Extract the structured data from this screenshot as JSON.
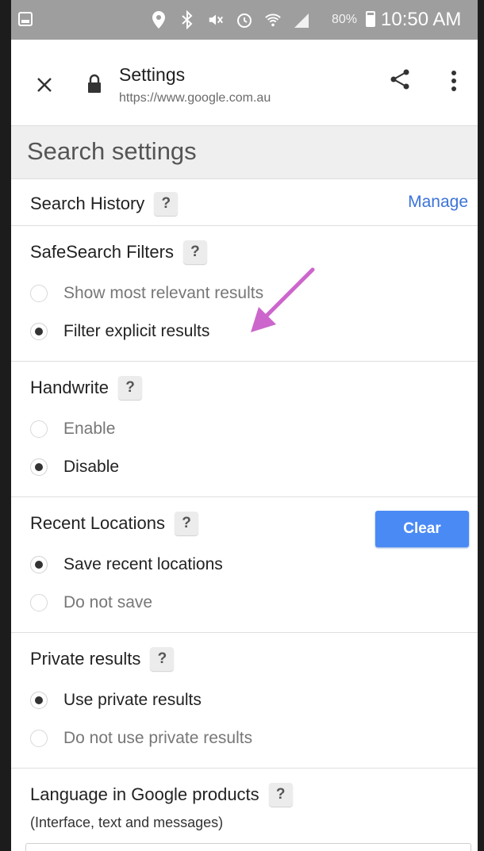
{
  "status_bar": {
    "battery_percent": "80%",
    "time": "10:50 AM",
    "icons": [
      "image-icon",
      "location-icon",
      "bluetooth-icon",
      "mute-icon",
      "alarm-icon",
      "wifi-icon",
      "signal-icon",
      "battery-icon"
    ]
  },
  "appbar": {
    "title": "Settings",
    "url": "https://www.google.com.au"
  },
  "page": {
    "heading": "Search settings"
  },
  "sections": {
    "search_history": {
      "title": "Search History",
      "help": "?",
      "action": "Manage"
    },
    "safesearch": {
      "title": "SafeSearch Filters",
      "help": "?",
      "options": [
        {
          "label": "Show most relevant results",
          "selected": false
        },
        {
          "label": "Filter explicit results",
          "selected": true
        }
      ]
    },
    "handwrite": {
      "title": "Handwrite",
      "help": "?",
      "options": [
        {
          "label": "Enable",
          "selected": false
        },
        {
          "label": "Disable",
          "selected": true
        }
      ]
    },
    "recent_locations": {
      "title": "Recent Locations",
      "help": "?",
      "action": "Clear",
      "options": [
        {
          "label": "Save recent locations",
          "selected": true
        },
        {
          "label": "Do not save",
          "selected": false
        }
      ]
    },
    "private_results": {
      "title": "Private results",
      "help": "?",
      "options": [
        {
          "label": "Use private results",
          "selected": true
        },
        {
          "label": "Do not use private results",
          "selected": false
        }
      ]
    },
    "language": {
      "title": "Language in Google products",
      "help": "?",
      "subtitle": "(Interface, text and messages)"
    }
  },
  "colors": {
    "accent_link": "#3b73d9",
    "clear_button": "#4a8af4",
    "annotation_arrow": "#cc66cc",
    "status_bar": "#9e9e9e"
  }
}
